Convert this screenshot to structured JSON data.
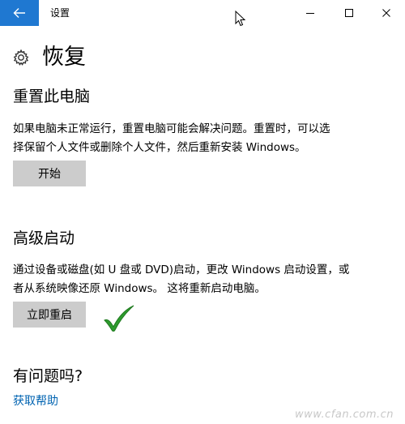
{
  "window": {
    "title": "设置",
    "back_icon": "arrow-left-icon",
    "accent_color": "#1f78d1",
    "controls": [
      "minimize-icon",
      "maximize-icon",
      "close-icon"
    ]
  },
  "page": {
    "icon": "gear-icon",
    "title": "恢复"
  },
  "reset_pc": {
    "heading": "重置此电脑",
    "description_lines": [
      "如果电脑未正常运行，重置电脑可能会解决问题。重置时，可以选",
      "择保留个人文件或删除个人文件，然后重新安装 Windows。"
    ],
    "button_label": "开始"
  },
  "advanced_startup": {
    "heading": "高级启动",
    "description_lines": [
      "通过设备或磁盘(如 U 盘或 DVD)启动，更改 Windows 启动设置，或",
      "者从系统映像还原 Windows。 这将重新启动电脑。"
    ],
    "button_label": "立即重启",
    "annotation_icon": "checkmark-icon",
    "annotation_color": "#2e9b2e"
  },
  "help": {
    "heading": "有问题吗?",
    "link_label": "获取帮助",
    "link_color": "#0063b1"
  },
  "watermark": "www.cfan.com.cn"
}
